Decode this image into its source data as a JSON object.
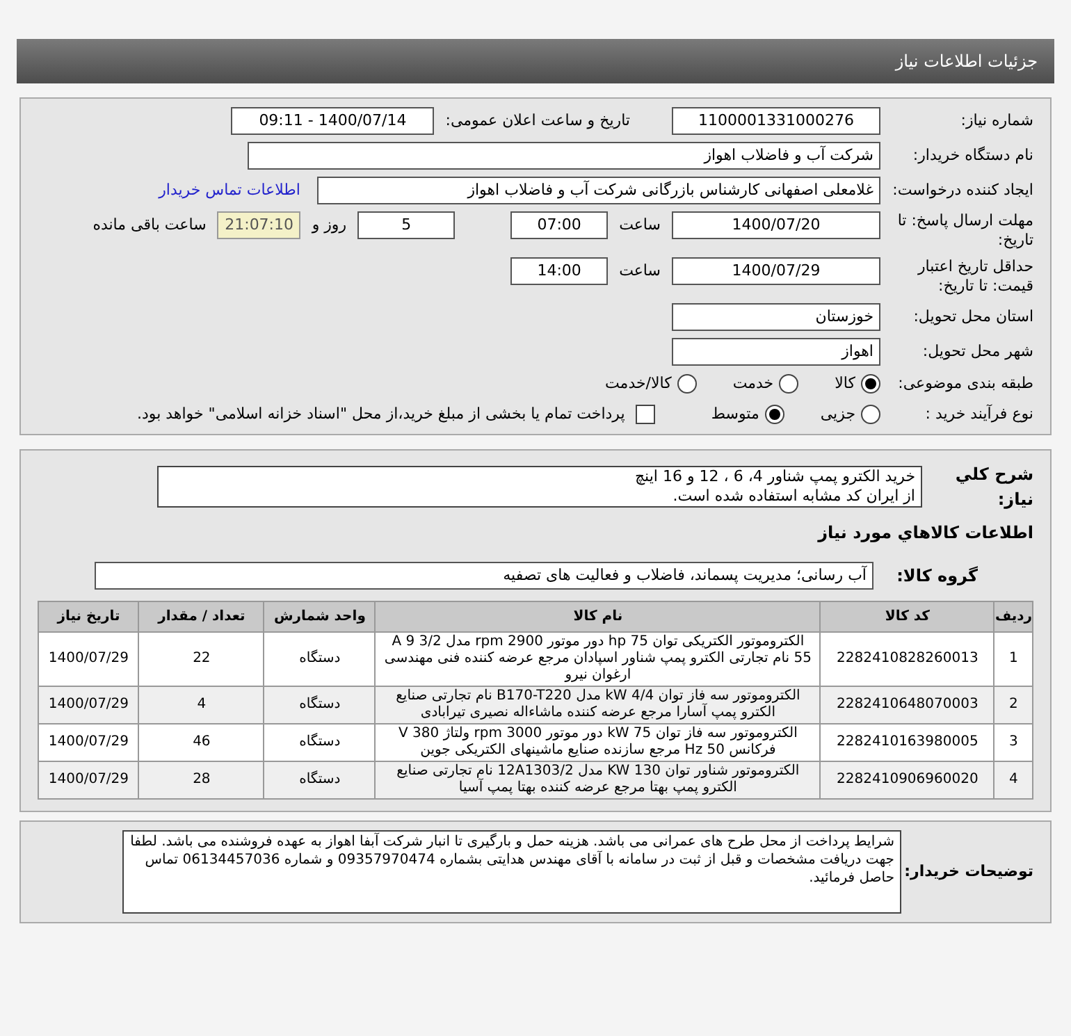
{
  "header": {
    "title": "جزئیات اطلاعات نیاز"
  },
  "need_number": {
    "label": "شماره نیاز:",
    "value": "1100001331000276"
  },
  "announce": {
    "label": "تاریخ و ساعت اعلان عمومی:",
    "value": "1400/07/14 - 09:11"
  },
  "buyer_org": {
    "label": "نام دستگاه خریدار:",
    "value": "شرکت آب و فاضلاب اهواز"
  },
  "requester": {
    "label": "ایجاد کننده درخواست:",
    "value": "غلامعلی اصفهانی کارشناس بازرگانی شرکت آب و فاضلاب اهواز",
    "link": "اطلاعات تماس خریدار"
  },
  "deadline": {
    "label": "مهلت ارسال پاسخ: تا تاریخ:",
    "date": "1400/07/20",
    "time_label": "ساعت",
    "time": "07:00",
    "days": "5",
    "days_label": "روز و",
    "remaining": "21:07:10",
    "remaining_label": "ساعت باقی مانده"
  },
  "validity": {
    "label": "حداقل تاریخ اعتبار قیمت: تا تاریخ:",
    "date": "1400/07/29",
    "time_label": "ساعت",
    "time": "14:00"
  },
  "province": {
    "label": "استان محل تحویل:",
    "value": "خوزستان"
  },
  "city": {
    "label": "شهر محل تحویل:",
    "value": "اهواز"
  },
  "category": {
    "label": "طبقه بندی موضوعی:",
    "options": [
      {
        "label": "کالا",
        "selected": true
      },
      {
        "label": "خدمت",
        "selected": false
      },
      {
        "label": "کالا/خدمت",
        "selected": false
      }
    ]
  },
  "process": {
    "label": "نوع فرآیند خرید :",
    "options": [
      {
        "label": "جزیی",
        "selected": false
      },
      {
        "label": "متوسط",
        "selected": true
      }
    ],
    "treasury": {
      "label": "پرداخت تمام یا بخشی از مبلغ خرید،از محل \"اسناد خزانه اسلامی\" خواهد بود.",
      "checked": false
    }
  },
  "description": {
    "label": "شرح کلي نياز:",
    "lines": [
      "خرید الکترو پمپ شناور 4، 6 ، 12 و 16 اینچ",
      "از ایران کد مشابه استفاده شده است."
    ]
  },
  "goods_title": "اطلاعات کالاهاي مورد نياز",
  "goods_group": {
    "label": "گروه کالا:",
    "value": "آب رسانی؛ مدیریت پسماند، فاضلاب و فعالیت های تصفیه"
  },
  "table": {
    "columns": [
      "ردیف",
      "کد کالا",
      "نام کالا",
      "واحد شمارش",
      "تعداد / مقدار",
      "تاریخ نیاز"
    ],
    "rows": [
      [
        "1",
        "2282410828260013",
        "الکتروموتور الکتریکی توان hp 75 دور موتور rpm 2900 مدل A 9 3/2 55 نام تجارتی الکترو پمپ شناور اسپادان مرجع عرضه کننده فنی مهندسی ارغوان نیرو",
        "دستگاه",
        "22",
        "1400/07/29"
      ],
      [
        "2",
        "2282410648070003",
        "الکتروموتور سه فاز توان kW 4/4 مدل B170-T220 نام تجارتی صنایع الکترو پمپ آسارا مرجع عرضه کننده ماشاءاله نصیری تیرابادی",
        "دستگاه",
        "4",
        "1400/07/29"
      ],
      [
        "3",
        "2282410163980005",
        "الکتروموتور سه فاز توان kW 75 دور موتور rpm 3000 ولتاژ 380 V فرکانس Hz 50 مرجع سازنده صنایع ماشینهای الکتریکی جوین",
        "دستگاه",
        "46",
        "1400/07/29"
      ],
      [
        "4",
        "2282410906960020",
        "الکتروموتور شناور توان KW 130 مدل 12A1303/2 نام تجارتی صنایع الکترو پمپ بهتا مرجع عرضه کننده بهتا پمپ آسیا",
        "دستگاه",
        "28",
        "1400/07/29"
      ]
    ]
  },
  "buyer_notes": {
    "label": "توضیحات خریدار:",
    "text": "شرایط پرداخت از محل طرح های عمرانی می باشد. هزینه حمل و بارگیری تا انبار شرکت آبفا اهواز به عهده فروشنده می باشد. لطفا جهت دریافت مشخصات و قبل از ثبت در سامانه با آقای مهندس هدایتی بشماره  09357970474 و شماره 06134457036  تماس حاصل فرمائید."
  }
}
